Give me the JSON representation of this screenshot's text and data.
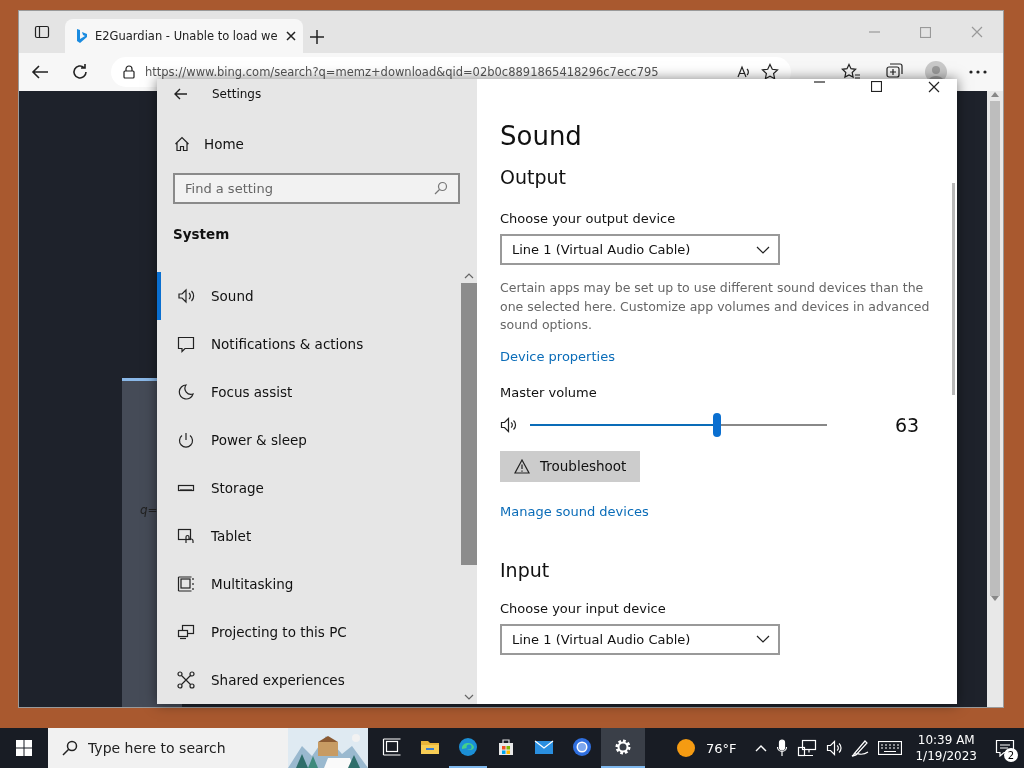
{
  "browser": {
    "tabs": [
      {
        "title": "E2Guardian - Unable to load we",
        "selected": true
      }
    ],
    "address": "https://www.bing.com/search?q=memz+download&qid=02b0c8891865418296c7ecc795",
    "page_fragment": "q="
  },
  "settings": {
    "title": "Settings",
    "home": "Home",
    "search": {
      "placeholder": "Find a setting"
    },
    "section": "System",
    "nav": [
      {
        "kind": "sound",
        "label": "Sound",
        "selected": true
      },
      {
        "kind": "notifications",
        "label": "Notifications & actions",
        "selected": false
      },
      {
        "kind": "focus",
        "label": "Focus assist",
        "selected": false
      },
      {
        "kind": "power",
        "label": "Power & sleep",
        "selected": false
      },
      {
        "kind": "storage",
        "label": "Storage",
        "selected": false
      },
      {
        "kind": "tablet",
        "label": "Tablet",
        "selected": false
      },
      {
        "kind": "multitasking",
        "label": "Multitasking",
        "selected": false
      },
      {
        "kind": "projecting",
        "label": "Projecting to this PC",
        "selected": false
      },
      {
        "kind": "shared",
        "label": "Shared experiences",
        "selected": false
      }
    ],
    "page": {
      "title": "Sound",
      "output": {
        "heading": "Output",
        "device_label": "Choose your output device",
        "device": "Line 1 (Virtual Audio Cable)",
        "note": "Certain apps may be set up to use different sound devices than the one selected here. Customize app volumes and devices in advanced sound options.",
        "properties_link": "Device properties",
        "volume_label": "Master volume",
        "volume": {
          "level": 0.63,
          "reading": "63"
        },
        "troubleshoot": "Troubleshoot",
        "manage_link": "Manage sound devices"
      },
      "input": {
        "heading": "Input",
        "device_label": "Choose your input device",
        "device": "Line 1 (Virtual Audio Cable)"
      }
    }
  },
  "taskbar": {
    "search": {
      "placeholder": "Type here to search"
    },
    "apps": [
      {
        "kind": "taskview",
        "running": false,
        "active": false
      },
      {
        "kind": "explorer",
        "running": false,
        "active": false
      },
      {
        "kind": "edge",
        "running": true,
        "active": false
      },
      {
        "kind": "store",
        "running": false,
        "active": false
      },
      {
        "kind": "mail",
        "running": false,
        "active": false
      },
      {
        "kind": "chrome",
        "running": false,
        "active": false
      },
      {
        "kind": "settings",
        "running": true,
        "active": true
      }
    ],
    "weather": "76°F",
    "time": "10:39 AM",
    "date": "1/19/2023",
    "notifications": "2"
  }
}
